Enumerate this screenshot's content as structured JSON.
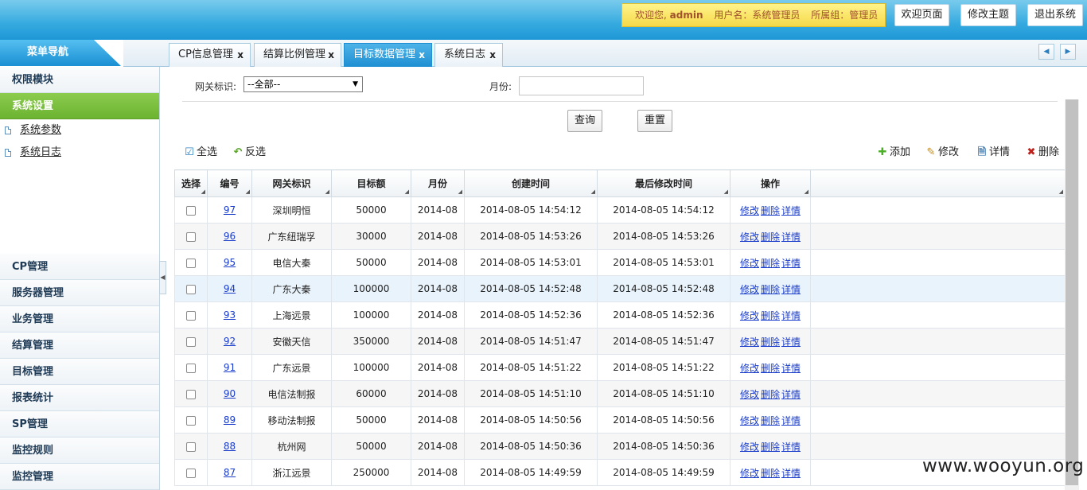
{
  "header": {
    "welcome_prefix": "欢迎您,",
    "welcome_user": "admin",
    "username_label": "用户名：系统管理员",
    "group_label": "所属组：管理员",
    "buttons": [
      "欢迎页面",
      "修改主题",
      "退出系统"
    ]
  },
  "menu_title": "菜单导航",
  "tabs": [
    {
      "label": "CP信息管理",
      "close": "x"
    },
    {
      "label": "结算比例管理",
      "close": "x"
    },
    {
      "label": "目标数据管理",
      "close": "x",
      "active": true
    },
    {
      "label": "系统日志",
      "close": "x"
    }
  ],
  "sidebar": {
    "top_section": "权限模块",
    "active_section": "系统设置",
    "sub_items": [
      "系统参数",
      "系统日志"
    ],
    "sections": [
      "CP管理",
      "服务器管理",
      "业务管理",
      "结算管理",
      "目标管理",
      "报表统计",
      "SP管理",
      "监控规则",
      "监控管理"
    ]
  },
  "filters": {
    "gateway_label": "网关标识:",
    "gateway_value": "--全部--",
    "month_label": "月份:",
    "month_value": ""
  },
  "actions": {
    "query": "查询",
    "reset": "重置"
  },
  "toolbar": {
    "select_all": "全选",
    "invert": "反选",
    "add": "添加",
    "edit": "修改",
    "detail": "详情",
    "delete": "删除"
  },
  "table": {
    "columns": [
      "选择",
      "编号",
      "网关标识",
      "目标额",
      "月份",
      "创建时间",
      "最后修改时间",
      "操作"
    ],
    "op_labels": [
      "修改",
      "删除",
      "详情"
    ],
    "rows": [
      {
        "id": "97",
        "gateway": "深圳明恒",
        "target": "50000",
        "month": "2014-08",
        "created": "2014-08-05 14:54:12",
        "modified": "2014-08-05 14:54:12"
      },
      {
        "id": "96",
        "gateway": "广东纽瑞孚",
        "target": "30000",
        "month": "2014-08",
        "created": "2014-08-05 14:53:26",
        "modified": "2014-08-05 14:53:26"
      },
      {
        "id": "95",
        "gateway": "电信大秦",
        "target": "50000",
        "month": "2014-08",
        "created": "2014-08-05 14:53:01",
        "modified": "2014-08-05 14:53:01"
      },
      {
        "id": "94",
        "gateway": "广东大秦",
        "target": "100000",
        "month": "2014-08",
        "created": "2014-08-05 14:52:48",
        "modified": "2014-08-05 14:52:48"
      },
      {
        "id": "93",
        "gateway": "上海远景",
        "target": "100000",
        "month": "2014-08",
        "created": "2014-08-05 14:52:36",
        "modified": "2014-08-05 14:52:36"
      },
      {
        "id": "92",
        "gateway": "安徽天信",
        "target": "350000",
        "month": "2014-08",
        "created": "2014-08-05 14:51:47",
        "modified": "2014-08-05 14:51:47"
      },
      {
        "id": "91",
        "gateway": "广东远景",
        "target": "100000",
        "month": "2014-08",
        "created": "2014-08-05 14:51:22",
        "modified": "2014-08-05 14:51:22"
      },
      {
        "id": "90",
        "gateway": "电信法制报",
        "target": "60000",
        "month": "2014-08",
        "created": "2014-08-05 14:51:10",
        "modified": "2014-08-05 14:51:10"
      },
      {
        "id": "89",
        "gateway": "移动法制报",
        "target": "50000",
        "month": "2014-08",
        "created": "2014-08-05 14:50:56",
        "modified": "2014-08-05 14:50:56"
      },
      {
        "id": "88",
        "gateway": "杭州网",
        "target": "50000",
        "month": "2014-08",
        "created": "2014-08-05 14:50:36",
        "modified": "2014-08-05 14:50:36"
      },
      {
        "id": "87",
        "gateway": "浙江远景",
        "target": "250000",
        "month": "2014-08",
        "created": "2014-08-05 14:49:59",
        "modified": "2014-08-05 14:49:59"
      }
    ]
  },
  "watermark": "www.wooyun.org"
}
